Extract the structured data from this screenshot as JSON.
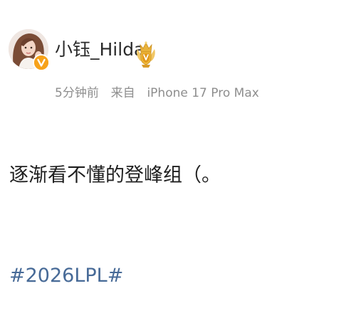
{
  "post": {
    "author": {
      "username": "小钰_Hilda",
      "avatar": "avatar-photo",
      "verified_icon": "verified-v-icon",
      "badge_icon": "crown-medal-icon"
    },
    "meta": {
      "time": "5分钟前",
      "source_prefix": "来自",
      "device": "iPhone 17 Pro Max"
    },
    "text": "逐渐看不懂的登峰组（。",
    "hashtag": "#2026LPL#"
  },
  "colors": {
    "text": "#1f1f1f",
    "meta": "#8e8e8e",
    "hashtag": "#476a97",
    "verified": "#f7a21a",
    "crown": "#e8b23a"
  }
}
